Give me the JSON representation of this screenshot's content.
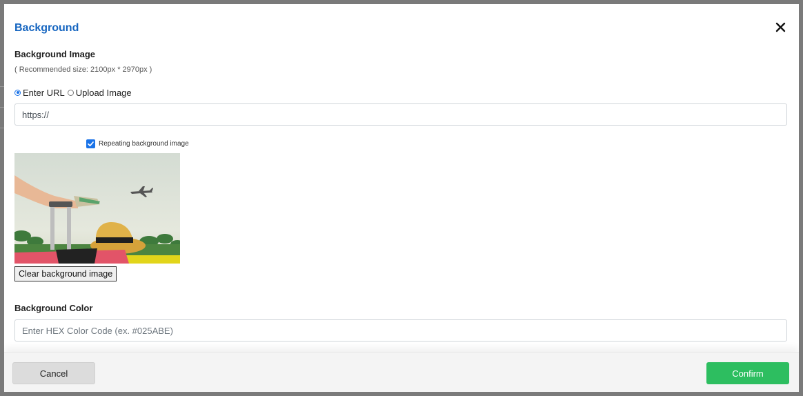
{
  "dialog": {
    "title": "Background",
    "close_icon": "close-icon"
  },
  "background_image": {
    "heading": "Background Image",
    "hint": "( Recommended size: 2100px * 2970px )",
    "source_options": [
      {
        "label": "Enter URL",
        "checked": true
      },
      {
        "label": "Upload Image",
        "checked": false
      }
    ],
    "url_value": "https://",
    "repeat_label": "Repeating background image",
    "repeat_checked": true,
    "clear_label": "Clear background image"
  },
  "background_color": {
    "heading": "Background Color",
    "placeholder": "Enter HEX Color Code (ex. #025ABE)"
  },
  "footer": {
    "cancel_label": "Cancel",
    "confirm_label": "Confirm"
  },
  "colors": {
    "title": "#1565c0",
    "confirm": "#2dbe60",
    "cancel": "#dcdcdc",
    "overlay": "#7a7a7a",
    "checkbox": "#1a73e8"
  }
}
